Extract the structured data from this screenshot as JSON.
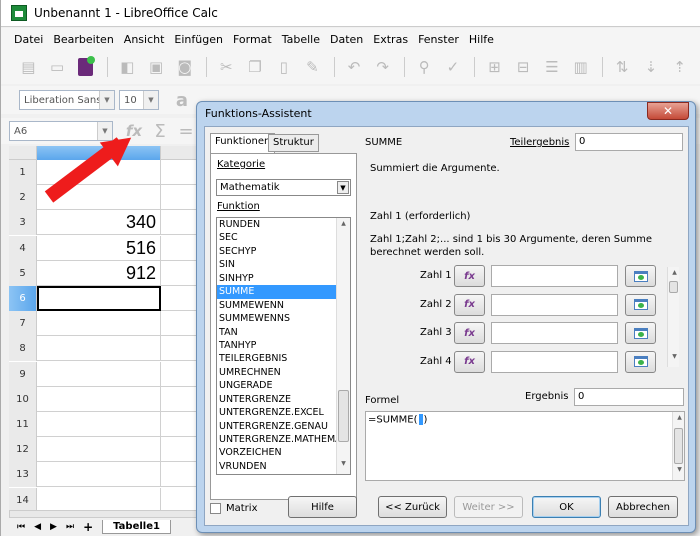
{
  "window": {
    "title": "Unbenannt 1 - LibreOffice Calc"
  },
  "menu": [
    "Datei",
    "Bearbeiten",
    "Ansicht",
    "Einfügen",
    "Format",
    "Tabelle",
    "Daten",
    "Extras",
    "Fenster",
    "Hilfe"
  ],
  "formatting": {
    "font_name": "Liberation Sans",
    "font_size": "10"
  },
  "formula_bar": {
    "name_box": "A6"
  },
  "sheet": {
    "rows": [
      {
        "num": "1",
        "a": ""
      },
      {
        "num": "2",
        "a": ""
      },
      {
        "num": "3",
        "a": "340"
      },
      {
        "num": "4",
        "a": "516"
      },
      {
        "num": "5",
        "a": "912"
      },
      {
        "num": "6",
        "a": ""
      },
      {
        "num": "7",
        "a": ""
      },
      {
        "num": "8",
        "a": ""
      },
      {
        "num": "9",
        "a": ""
      },
      {
        "num": "10",
        "a": ""
      },
      {
        "num": "11",
        "a": ""
      },
      {
        "num": "12",
        "a": ""
      },
      {
        "num": "13",
        "a": ""
      },
      {
        "num": "14",
        "a": ""
      }
    ],
    "active_row": "6",
    "tab": "Tabelle1"
  },
  "dialog": {
    "title": "Funktions-Assistent",
    "close": "✕",
    "tabs": [
      "Funktionen",
      "Struktur"
    ],
    "kategorie_label": "Kategorie",
    "kategorie_value": "Mathematik",
    "funktion_label": "Funktion",
    "functions": [
      "RUNDEN",
      "SEC",
      "SECHYP",
      "SIN",
      "SINHYP",
      "SUMME",
      "SUMMEWENN",
      "SUMMEWENNS",
      "TAN",
      "TANHYP",
      "TEILERGEBNIS",
      "UMRECHNEN",
      "UNGERADE",
      "UNTERGRENZE",
      "UNTERGRENZE.EXCEL",
      "UNTERGRENZE.GENAU",
      "UNTERGRENZE.MATHEMATIK",
      "VORZEICHEN",
      "VRUNDEN"
    ],
    "selected_function": "SUMME",
    "function_name": "SUMME",
    "teilergebnis_label": "Teilergebnis",
    "teilergebnis_value": "0",
    "description": "Summiert die Argumente.",
    "arg_title": "Zahl 1 (erforderlich)",
    "arg_description": "Zahl 1;Zahl 2;... sind 1 bis 30 Argumente, deren Summe berechnet werden soll.",
    "args": [
      {
        "label": "Zahl 1",
        "value": ""
      },
      {
        "label": "Zahl 2",
        "value": ""
      },
      {
        "label": "Zahl 3",
        "value": ""
      },
      {
        "label": "Zahl 4",
        "value": ""
      }
    ],
    "formel_label": "Formel",
    "ergebnis_label": "Ergebnis",
    "ergebnis_value": "0",
    "formula_before": "=SUMME(",
    "formula_after": ")",
    "matrix_label": "Matrix",
    "buttons": {
      "help": "Hilfe",
      "back": "<< Zurück",
      "next": "Weiter >>",
      "ok": "OK",
      "cancel": "Abbrechen"
    }
  }
}
